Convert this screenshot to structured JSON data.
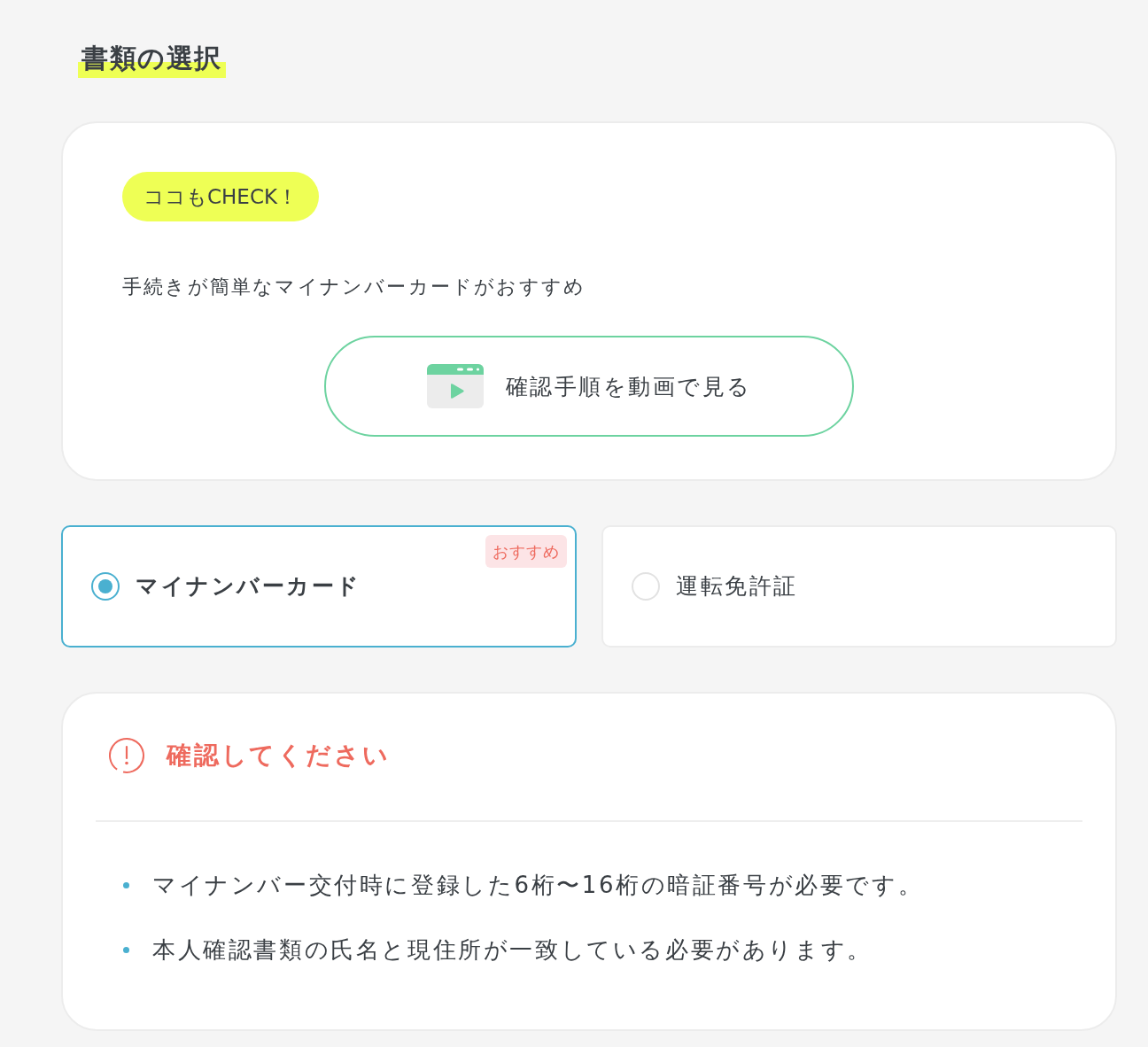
{
  "section_title": "書類の選択",
  "info_card": {
    "badge": "ココもCHECK！",
    "text": "手続きが簡単なマイナンバーカードがおすすめ",
    "video_button": {
      "label": "確認手順を動画で見る"
    }
  },
  "document_options": [
    {
      "label": "マイナンバーカード",
      "selected": true,
      "badge": "おすすめ"
    },
    {
      "label": "運転免許証",
      "selected": false
    }
  ],
  "notice": {
    "title": "確認してください",
    "items": [
      "マイナンバー交付時に登録した6桁〜16桁の暗証番号が必要です。",
      "本人確認書類の氏名と現住所が一致している必要があります。"
    ]
  }
}
